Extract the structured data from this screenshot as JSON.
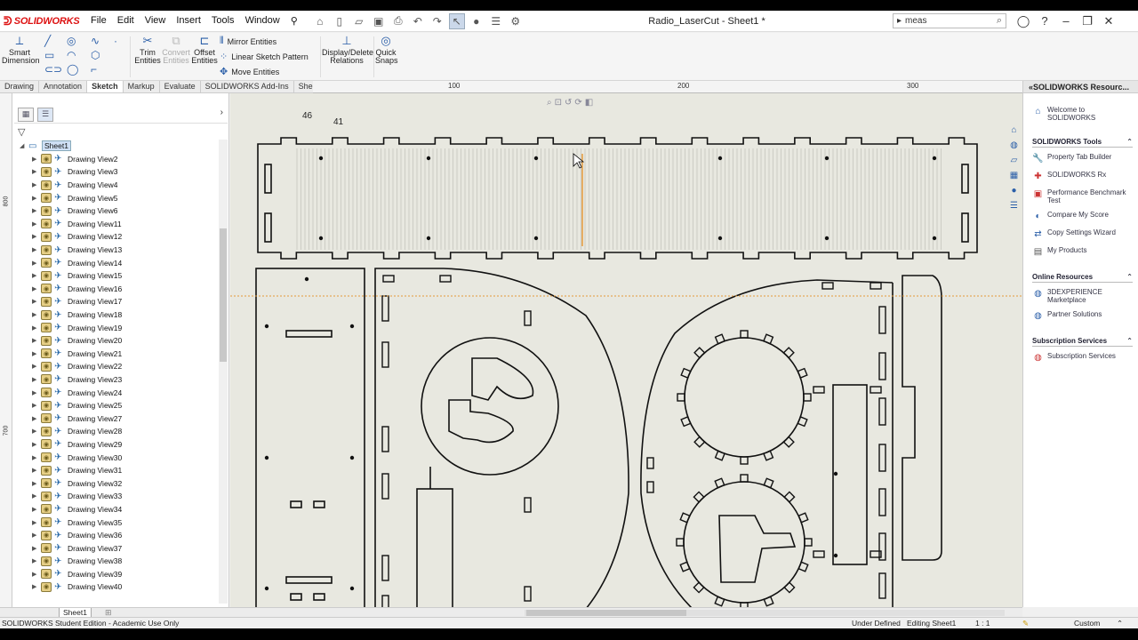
{
  "app": {
    "logo": "SOLIDWORKS",
    "doc_title": "Radio_LaserCut - Sheet1 *"
  },
  "menu": [
    "File",
    "Edit",
    "View",
    "Insert",
    "Tools",
    "Window"
  ],
  "search": {
    "value": "meas"
  },
  "commands": {
    "smart_dimension": "Smart Dimension",
    "trim_entities": "Trim Entities",
    "convert_entities": "Convert Entities",
    "offset_entities": "Offset Entities",
    "mirror_entities": "Mirror Entities",
    "linear_sketch_pattern": "Linear Sketch Pattern",
    "move_entities": "Move Entities",
    "display_delete_relations": "Display/Delete Relations",
    "quick_snaps": "Quick Snaps"
  },
  "tabs": [
    "Drawing",
    "Annotation",
    "Sketch",
    "Markup",
    "Evaluate",
    "SOLIDWORKS Add-Ins",
    "Sheet Format"
  ],
  "active_tab": "Sketch",
  "ruler": {
    "top": [
      "100",
      "200",
      "300"
    ],
    "left": [
      "800",
      "700"
    ]
  },
  "tree": {
    "root": "Sheet1",
    "views": [
      "Drawing View2",
      "Drawing View3",
      "Drawing View4",
      "Drawing View5",
      "Drawing View6",
      "Drawing View11",
      "Drawing View12",
      "Drawing View13",
      "Drawing View14",
      "Drawing View15",
      "Drawing View16",
      "Drawing View17",
      "Drawing View18",
      "Drawing View19",
      "Drawing View20",
      "Drawing View21",
      "Drawing View22",
      "Drawing View23",
      "Drawing View24",
      "Drawing View25",
      "Drawing View27",
      "Drawing View28",
      "Drawing View29",
      "Drawing View30",
      "Drawing View31",
      "Drawing View32",
      "Drawing View33",
      "Drawing View34",
      "Drawing View35",
      "Drawing View36",
      "Drawing View37",
      "Drawing View38",
      "Drawing View39",
      "Drawing View40"
    ]
  },
  "canvas": {
    "label_a": "46",
    "label_b": "41"
  },
  "task_pane": {
    "title": "SOLIDWORKS Resourc...",
    "welcome": "Welcome to SOLIDWORKS",
    "sections": [
      {
        "title": "SOLIDWORKS Tools",
        "items": [
          "Property Tab Builder",
          "SOLIDWORKS Rx",
          "Performance Benchmark Test",
          "Compare My Score",
          "Copy Settings Wizard",
          "My Products"
        ]
      },
      {
        "title": "Online Resources",
        "items": [
          "3DEXPERIENCE Marketplace",
          "Partner Solutions"
        ]
      },
      {
        "title": "Subscription Services",
        "items": [
          "Subscription Services"
        ]
      }
    ]
  },
  "sheet_tab": "Sheet1",
  "status": {
    "edition": "SOLIDWORKS Student Edition - Academic Use Only",
    "definition": "Under Defined",
    "editing": "Editing Sheet1",
    "scale": "1 : 1",
    "units": "Custom"
  },
  "colors": {
    "brand": "#d11111",
    "accent": "#2a5ea8",
    "canvas": "#e8e8e0"
  }
}
